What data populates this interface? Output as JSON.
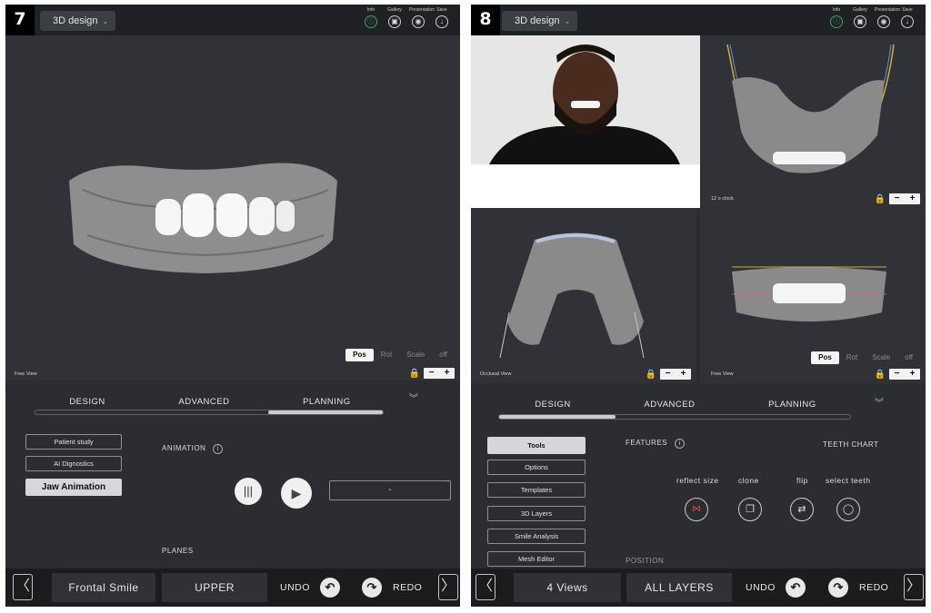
{
  "panel7": {
    "number": "7",
    "mode": "3D design",
    "top_icons": [
      {
        "label": "Info",
        "icon": "info-icon",
        "glyph": "ⓘ"
      },
      {
        "label": "Gallery",
        "icon": "gallery-icon",
        "glyph": "▣"
      },
      {
        "label": "Presentation",
        "icon": "presentation-icon",
        "glyph": "◉"
      },
      {
        "label": "Save",
        "icon": "save-icon",
        "glyph": "↓"
      }
    ],
    "view_label": "Free View",
    "toggle": [
      "Pos",
      "Rot",
      "Scale",
      "off"
    ],
    "toggle_active": "Pos",
    "tabs": [
      "DESIGN",
      "ADVANCED",
      "PLANNING"
    ],
    "active_tab": "PLANNING",
    "side_buttons": [
      "Patient study",
      "AI Dignostics",
      "Jaw Animation"
    ],
    "active_side": "Jaw Animation",
    "animation_label": "ANIMATION",
    "animation_value": "-",
    "planes_label": "PLANES",
    "bottom": {
      "left_btn": "Frontal Smile",
      "right_btn": "UPPER",
      "undo": "UNDO",
      "redo": "REDO"
    }
  },
  "panel8": {
    "number": "8",
    "mode": "3D design",
    "top_icons": [
      {
        "label": "Info",
        "icon": "info-icon",
        "glyph": "ⓘ"
      },
      {
        "label": "Gallery",
        "icon": "gallery-icon",
        "glyph": "▣"
      },
      {
        "label": "Presentation",
        "icon": "presentation-icon",
        "glyph": "◉"
      },
      {
        "label": "Save",
        "icon": "save-icon",
        "glyph": "↓"
      }
    ],
    "view_labels": {
      "top_right": "12 o clock",
      "bottom_left": "Occlusal View",
      "bottom_right": "Free View"
    },
    "toggle": [
      "Pos",
      "Rot",
      "Scale",
      "off"
    ],
    "toggle_active": "Pos",
    "tabs": [
      "DESIGN",
      "ADVANCED",
      "PLANNING"
    ],
    "active_tab": "DESIGN",
    "side_buttons": [
      "Tools",
      "Options",
      "Templates",
      "3D Layers",
      "Smile Analysis",
      "Mesh Editor"
    ],
    "active_side": "Tools",
    "features_label": "FEATURES",
    "teeth_chart_label": "TEETH CHART",
    "features": [
      {
        "label": "reflect size",
        "icon": "reflect-size-icon"
      },
      {
        "label": "clone",
        "icon": "clone-icon"
      },
      {
        "label": "flip",
        "icon": "flip-icon"
      },
      {
        "label": "select teeth",
        "icon": "select-teeth-icon"
      }
    ],
    "partial_label": "POSITION",
    "bottom": {
      "left_btn": "4 Views",
      "right_btn": "ALL LAYERS",
      "undo": "UNDO",
      "redo": "REDO"
    }
  },
  "colors": {
    "panel_bg": "#2b2d30",
    "topbar": "#1f2124",
    "active_tab": "#c9cbd0",
    "gum": "#8e8e8e",
    "teeth": "#f5f5f5",
    "info_green": "#3aa55c"
  }
}
